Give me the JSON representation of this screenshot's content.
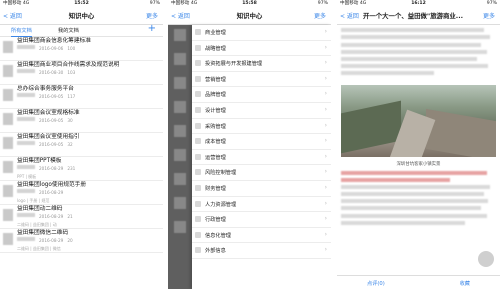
{
  "screen1": {
    "status": {
      "carrier": "中国移动 4G",
      "time": "15:52",
      "battery": "97%"
    },
    "nav": {
      "back": "< 返回",
      "title": "知识中心",
      "more": "更多"
    },
    "tabs": [
      {
        "label": "所有文档"
      },
      {
        "label": "我的文档"
      }
    ],
    "add": "+",
    "docs": [
      {
        "title": "益田集团商会信息化筹建标准",
        "date": "2016-09-06",
        "views": "100"
      },
      {
        "title": "益田集团商业项目合作线需求及规范说明",
        "date": "2016-08-30",
        "views": "103"
      },
      {
        "title": "总办综合事务服务平台",
        "date": "2016-09-05",
        "views": "117"
      },
      {
        "title": "益田集团会议室规格标准",
        "date": "2016-09-05",
        "views": "30"
      },
      {
        "title": "益田集团会议室使用指引",
        "date": "2016-09-05",
        "views": "32"
      },
      {
        "title": "益田集团PPT模板",
        "date": "2016-08-29",
        "views": "231",
        "tags": "PPT | 模板"
      },
      {
        "title": "益田集团logo使用规范手册",
        "date": "2016-08-29",
        "views": "",
        "tags": "logo | 手册 | 规范"
      },
      {
        "title": "益田集团动二维码",
        "date": "2016-08-29",
        "views": "21",
        "tags": "二维码 | 益田集团 | 动"
      },
      {
        "title": "益田集团微信二维码",
        "date": "2016-08-29",
        "views": "20",
        "tags": "二维码 | 益田集团 | 微信"
      }
    ]
  },
  "screen2": {
    "status": {
      "carrier": "中国移动 4G",
      "time": "15:58",
      "battery": "97%"
    },
    "nav": {
      "back": "< 返回",
      "title": "知识中心",
      "more": "更多"
    },
    "menu": [
      {
        "label": "商业管理"
      },
      {
        "label": "战略管理"
      },
      {
        "label": "投资拓展与开发报建管理"
      },
      {
        "label": "营销管理"
      },
      {
        "label": "品牌管理"
      },
      {
        "label": "设计管理"
      },
      {
        "label": "采购管理"
      },
      {
        "label": "成本管理"
      },
      {
        "label": "运营管理"
      },
      {
        "label": "风险控制管理"
      },
      {
        "label": "财务管理"
      },
      {
        "label": "人力资源管理"
      },
      {
        "label": "行政管理"
      },
      {
        "label": "信息化管理"
      },
      {
        "label": "外部信息"
      }
    ]
  },
  "screen3": {
    "status": {
      "carrier": "中国移动 4G",
      "time": "16:12",
      "battery": "97%"
    },
    "nav": {
      "back": "< 返回",
      "title": "开一个大一个、益田做\"旅游商业...",
      "more": "更多"
    },
    "photo_caption": "深圳甘坑客家小镇实景",
    "bottom": {
      "comment": "点评(0)",
      "favorite": "收藏"
    }
  },
  "colors": {
    "accent": "#3a86e8",
    "drawer_overlay": "#5f5f5f"
  }
}
